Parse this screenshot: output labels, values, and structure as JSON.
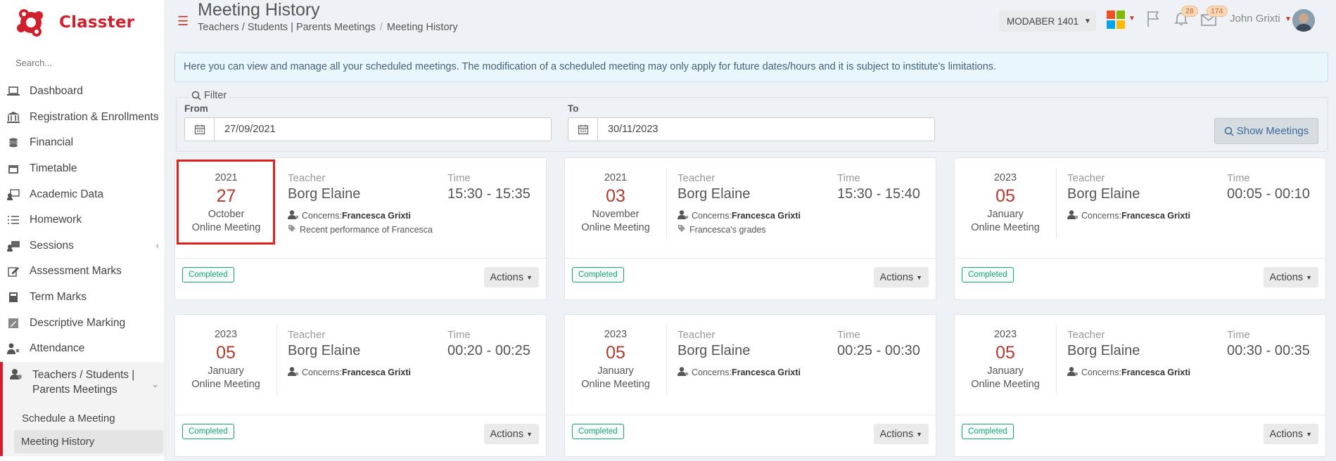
{
  "app": {
    "name": "Classter"
  },
  "sidebar": {
    "search_placeholder": "Search...",
    "items": [
      {
        "label": "Dashboard",
        "icon": "laptop-icon",
        "chevron": ""
      },
      {
        "label": "Registration & Enrollments",
        "icon": "bank-icon",
        "chevron": "‹"
      },
      {
        "label": "Financial",
        "icon": "coins-icon",
        "chevron": ""
      },
      {
        "label": "Timetable",
        "icon": "calendar-icon",
        "chevron": ""
      },
      {
        "label": "Academic Data",
        "icon": "user-board-icon",
        "chevron": ""
      },
      {
        "label": "Homework",
        "icon": "list-icon",
        "chevron": ""
      },
      {
        "label": "Sessions",
        "icon": "presentation-icon",
        "chevron": "‹"
      },
      {
        "label": "Assessment Marks",
        "icon": "edit-icon",
        "chevron": ""
      },
      {
        "label": "Term Marks",
        "icon": "book-icon",
        "chevron": ""
      },
      {
        "label": "Descriptive Marking",
        "icon": "pencil-icon",
        "chevron": ""
      },
      {
        "label": "Attendance",
        "icon": "user-x-icon",
        "chevron": ""
      }
    ],
    "active_group": {
      "label": "Teachers / Students | Parents Meetings",
      "icon": "users-cog-icon",
      "chevron": "⌄"
    },
    "sub_items": [
      {
        "label": "Schedule a Meeting"
      },
      {
        "label": "Meeting History"
      }
    ]
  },
  "header": {
    "title": "Meeting History",
    "breadcrumb": [
      "Teachers / Students | Parents Meetings",
      "Meeting History"
    ],
    "year_select": "MODABER 1401",
    "notifications_count": "28",
    "messages_count": "174",
    "user_name": "John Grixti",
    "colors": {
      "ms_red": "#f25022",
      "ms_green": "#7fba00",
      "ms_blue": "#00a4ef",
      "ms_yellow": "#ffb900",
      "accent": "#d0202e"
    }
  },
  "alert": {
    "text": "Here you can view and manage all your scheduled meetings. The modification of a scheduled meeting may only apply for future dates/hours and it is subject to institute's limitations."
  },
  "filter": {
    "legend": "Filter",
    "from_label": "From",
    "from_value": "27/09/2021",
    "to_label": "To",
    "to_value": "30/11/2023",
    "show_button": "Show Meetings"
  },
  "meetings": [
    {
      "year": "2021",
      "day": "27",
      "month": "October",
      "kind": "Online Meeting",
      "teacher_label": "Teacher",
      "teacher": "Borg Elaine",
      "time_label": "Time",
      "time": "15:30 - 15:35",
      "concerns_label": "Concerns:",
      "concerns": "Francesca Grixti",
      "topic": "Recent performance of Francesca",
      "status": "Completed",
      "actions": "Actions"
    },
    {
      "year": "2021",
      "day": "03",
      "month": "November",
      "kind": "Online Meeting",
      "teacher_label": "Teacher",
      "teacher": "Borg Elaine",
      "time_label": "Time",
      "time": "15:30 - 15:40",
      "concerns_label": "Concerns:",
      "concerns": "Francesca Grixti",
      "topic": "Francesca's grades",
      "status": "Completed",
      "actions": "Actions"
    },
    {
      "year": "2023",
      "day": "05",
      "month": "January",
      "kind": "Online Meeting",
      "teacher_label": "Teacher",
      "teacher": "Borg Elaine",
      "time_label": "Time",
      "time": "00:05 - 00:10",
      "concerns_label": "Concerns:",
      "concerns": "Francesca Grixti",
      "topic": "",
      "status": "Completed",
      "actions": "Actions"
    },
    {
      "year": "2023",
      "day": "05",
      "month": "January",
      "kind": "Online Meeting",
      "teacher_label": "Teacher",
      "teacher": "Borg Elaine",
      "time_label": "Time",
      "time": "00:20 - 00:25",
      "concerns_label": "Concerns:",
      "concerns": "Francesca Grixti",
      "topic": "",
      "status": "Completed",
      "actions": "Actions"
    },
    {
      "year": "2023",
      "day": "05",
      "month": "January",
      "kind": "Online Meeting",
      "teacher_label": "Teacher",
      "teacher": "Borg Elaine",
      "time_label": "Time",
      "time": "00:25 - 00:30",
      "concerns_label": "Concerns:",
      "concerns": "Francesca Grixti",
      "topic": "",
      "status": "Completed",
      "actions": "Actions"
    },
    {
      "year": "2023",
      "day": "05",
      "month": "January",
      "kind": "Online Meeting",
      "teacher_label": "Teacher",
      "teacher": "Borg Elaine",
      "time_label": "Time",
      "time": "00:30 - 00:35",
      "concerns_label": "Concerns:",
      "concerns": "Francesca Grixti",
      "topic": "",
      "status": "Completed",
      "actions": "Actions"
    }
  ]
}
